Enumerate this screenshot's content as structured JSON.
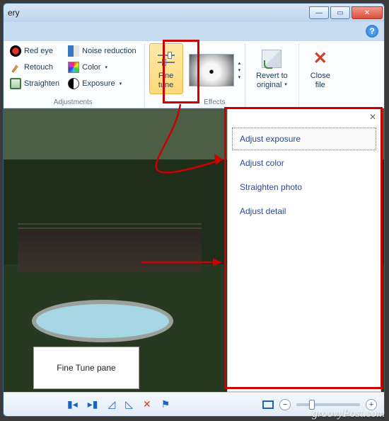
{
  "window": {
    "title_fragment": "ery"
  },
  "ribbon": {
    "adjustments": {
      "label": "Adjustments",
      "redeye": "Red eye",
      "retouch": "Retouch",
      "straighten": "Straighten",
      "noise": "Noise reduction",
      "color": "Color",
      "exposure": "Exposure"
    },
    "finetune": {
      "line1": "Fine",
      "line2": "tune"
    },
    "effects": {
      "label": "Effects"
    },
    "revert": {
      "line1": "Revert to",
      "line2": "original"
    },
    "close": {
      "line1": "Close",
      "line2": "file"
    }
  },
  "panel": {
    "items": [
      {
        "label": "Adjust exposure",
        "selected": true
      },
      {
        "label": "Adjust color",
        "selected": false
      },
      {
        "label": "Straighten photo",
        "selected": false
      },
      {
        "label": "Adjust detail",
        "selected": false
      }
    ]
  },
  "callout": {
    "text": "Fine Tune pane"
  },
  "watermark": "groovyPost.com"
}
